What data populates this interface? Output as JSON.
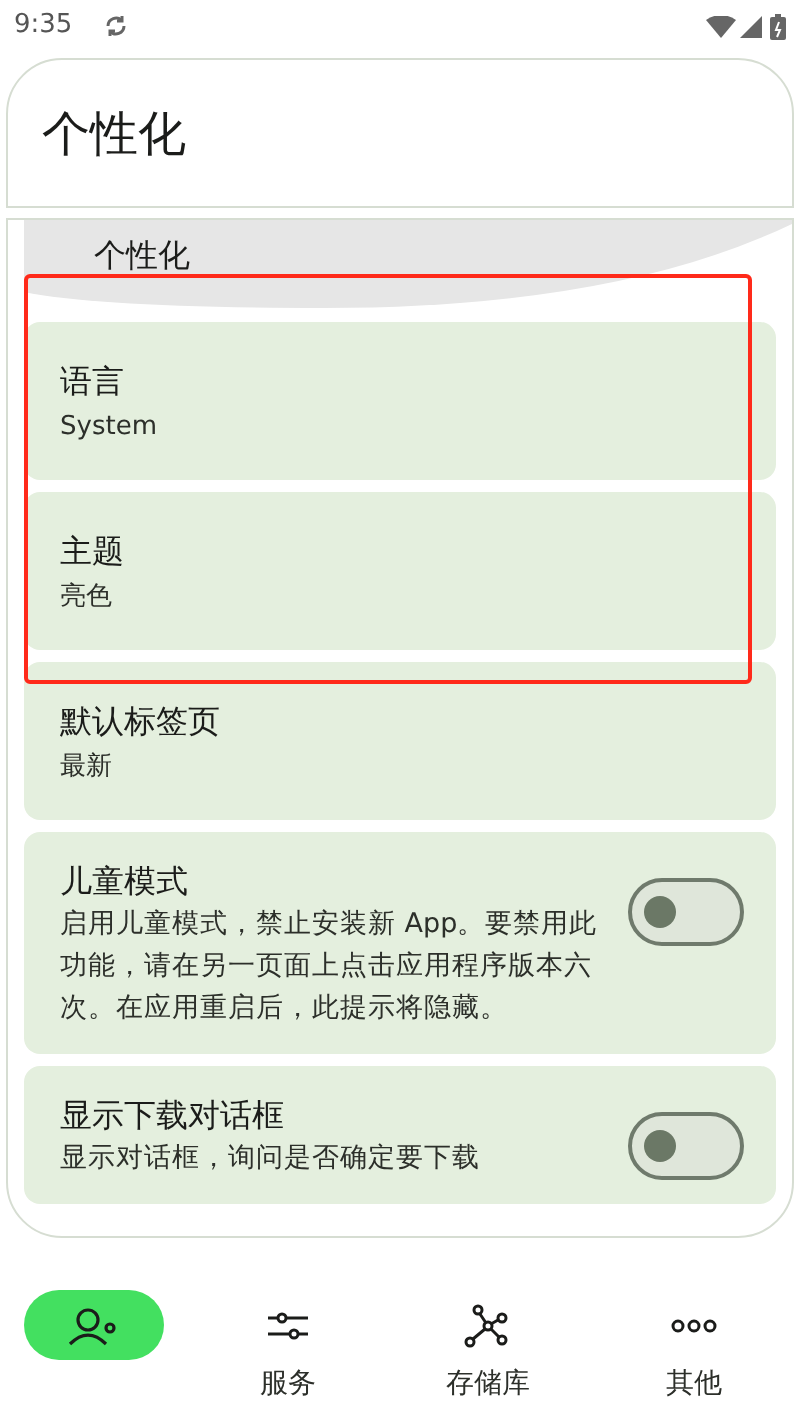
{
  "status_bar": {
    "time": "9:35"
  },
  "header": {
    "title": "个性化"
  },
  "section": {
    "title": "个性化"
  },
  "settings": [
    {
      "kind": "choice",
      "title": "语言",
      "value": "System"
    },
    {
      "kind": "choice",
      "title": "主题",
      "value": "亮色"
    },
    {
      "kind": "choice",
      "title": "默认标签页",
      "value": "最新"
    },
    {
      "kind": "switch",
      "title": "儿童模式",
      "description": "启用儿童模式，禁止安装新 App。要禁用此功能，请在另一页面上点击应用程序版本六次。在应用重启后，此提示将隐藏。",
      "on": false
    },
    {
      "kind": "switch",
      "title": "显示下载对话框",
      "description": "显示对话框，询问是否确定要下载",
      "on": false
    }
  ],
  "nav": [
    {
      "kind": "profile",
      "selected": true
    },
    {
      "kind": "sliders",
      "label": "服务",
      "selected": false
    },
    {
      "kind": "graph",
      "label": "存储库",
      "selected": false
    },
    {
      "kind": "more",
      "label": "其他",
      "selected": false
    }
  ]
}
